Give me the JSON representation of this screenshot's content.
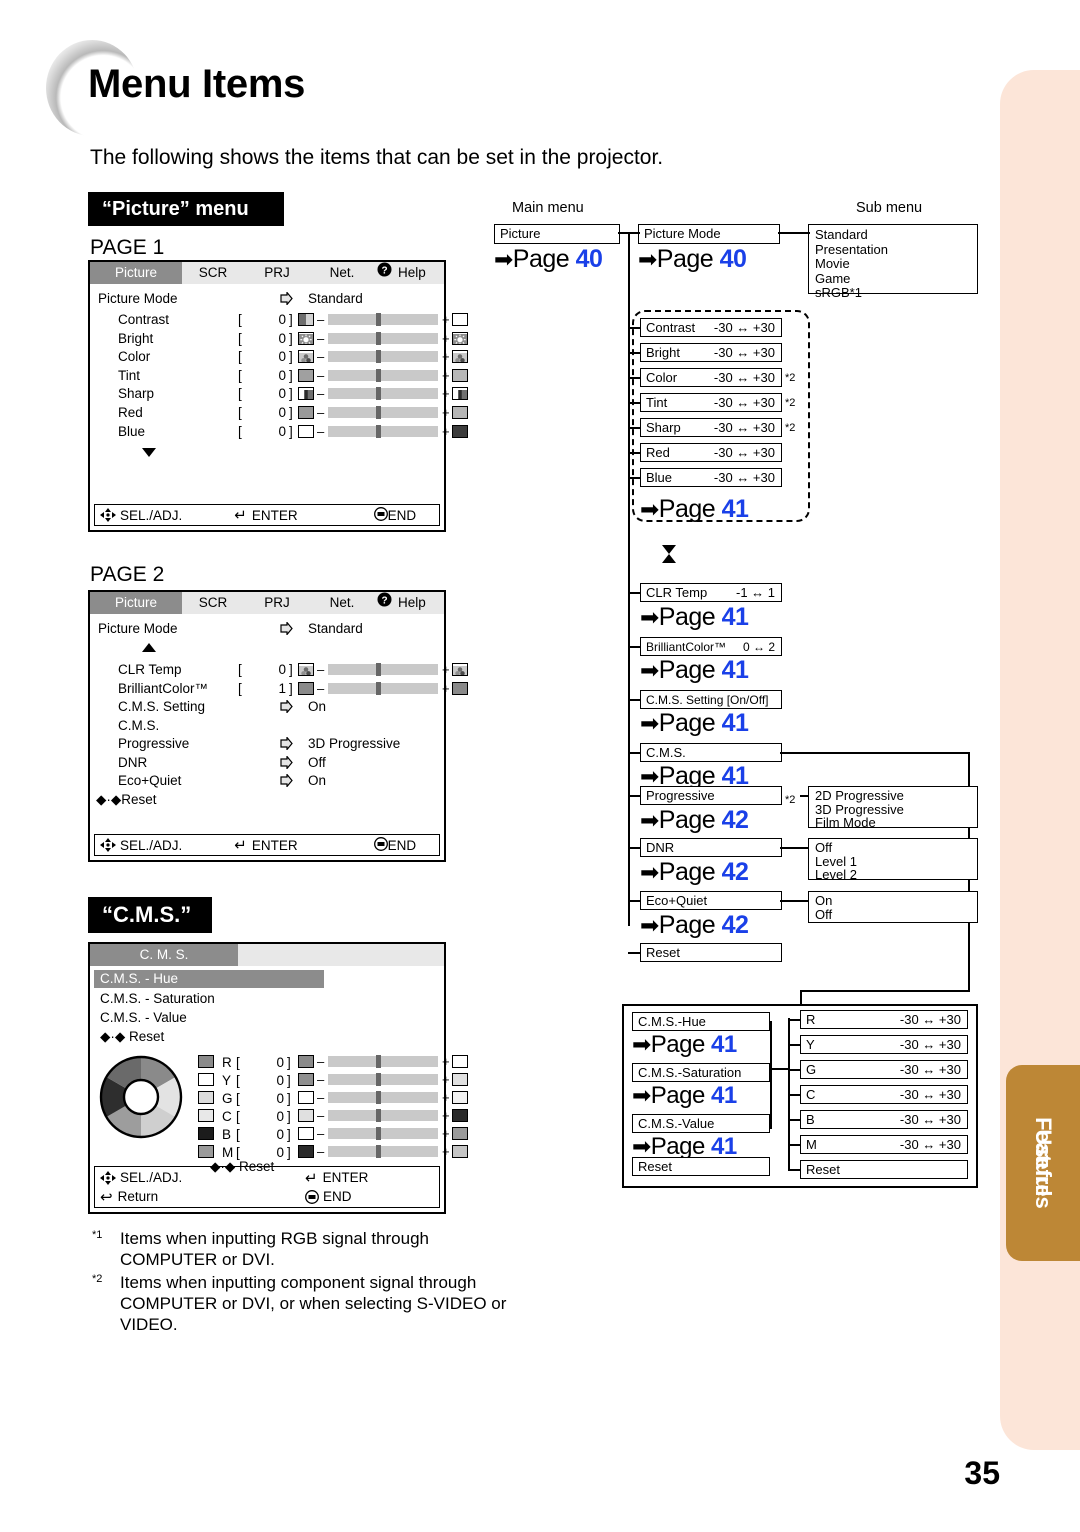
{
  "header": {
    "title": "Menu Items",
    "intro": "The following shows the items that can be set in the projector.",
    "picture_band": "“Picture” menu",
    "cms_band": "“C.M.S.”",
    "page1_label": "PAGE 1",
    "page2_label": "PAGE 2"
  },
  "osd": {
    "tabs": [
      "Picture",
      "SCR",
      "PRJ",
      "Net.",
      "Help"
    ],
    "help_icon": "question-mark-icon",
    "footer": {
      "sel": "SEL./ADJ.",
      "enter": "ENTER",
      "end": "END",
      "return": "Return"
    },
    "page1": {
      "picture_mode_label": "Picture Mode",
      "picture_mode_value": "Standard",
      "rows": [
        {
          "label": "Contrast",
          "value": "0"
        },
        {
          "label": "Bright",
          "value": "0"
        },
        {
          "label": "Color",
          "value": "0"
        },
        {
          "label": "Tint",
          "value": "0"
        },
        {
          "label": "Sharp",
          "value": "0"
        },
        {
          "label": "Red",
          "value": "0"
        },
        {
          "label": "Blue",
          "value": "0"
        }
      ]
    },
    "page2": {
      "picture_mode_label": "Picture Mode",
      "picture_mode_value": "Standard",
      "sliders": [
        {
          "label": "CLR Temp",
          "value": "0"
        },
        {
          "label": "BrilliantColor™",
          "value": "1"
        }
      ],
      "items": [
        {
          "label": "C.M.S. Setting",
          "value": "On"
        },
        {
          "label": "C.M.S.",
          "value": ""
        },
        {
          "label": "Progressive",
          "value": "3D Progressive"
        },
        {
          "label": "DNR",
          "value": "Off"
        },
        {
          "label": "Eco+Quiet",
          "value": "On"
        }
      ],
      "reset": "Reset"
    },
    "cms": {
      "tab": "C. M. S.",
      "menu": [
        "C.M.S. - Hue",
        "C.M.S. - Saturation",
        "C.M.S. - Value"
      ],
      "reset_top": "Reset",
      "reset_bottom": "Reset",
      "channels": [
        {
          "label": "R",
          "value": "0"
        },
        {
          "label": "Y",
          "value": "0"
        },
        {
          "label": "G",
          "value": "0"
        },
        {
          "label": "C",
          "value": "0"
        },
        {
          "label": "B",
          "value": "0"
        },
        {
          "label": "M",
          "value": "0"
        }
      ]
    }
  },
  "flow": {
    "main_menu_caption": "Main menu",
    "sub_menu_caption": "Sub menu",
    "picture_box": "Picture",
    "picture_page": "40",
    "picture_mode_box": "Picture Mode",
    "picture_mode_page": "40",
    "picture_mode_options": [
      "Standard",
      "Presentation",
      "Movie",
      "Game",
      "sRGB*1"
    ],
    "adjust_items": [
      {
        "label": "Contrast",
        "range": "-30 ↔ +30",
        "note": ""
      },
      {
        "label": "Bright",
        "range": "-30 ↔ +30",
        "note": ""
      },
      {
        "label": "Color",
        "range": "-30 ↔ +30",
        "note": "*2"
      },
      {
        "label": "Tint",
        "range": "-30 ↔ +30",
        "note": "*2"
      },
      {
        "label": "Sharp",
        "range": "-30 ↔ +30",
        "note": "*2"
      },
      {
        "label": "Red",
        "range": "-30 ↔ +30",
        "note": ""
      },
      {
        "label": "Blue",
        "range": "-30 ↔ +30",
        "note": ""
      }
    ],
    "adjust_page": "41",
    "clr_temp": {
      "label": "CLR Temp",
      "range": "-1 ↔ 1",
      "page": "41"
    },
    "brilliant_color": {
      "label": "BrilliantColor™",
      "range": "0 ↔ 2",
      "page": "41"
    },
    "cms_setting": {
      "label": "C.M.S. Setting [On/Off]",
      "page": "41"
    },
    "cms": {
      "label": "C.M.S.",
      "page": "41"
    },
    "progressive": {
      "label": "Progressive",
      "note": "*2",
      "page": "42",
      "options": [
        "2D Progressive",
        "3D Progressive",
        "Film Mode"
      ]
    },
    "dnr": {
      "label": "DNR",
      "page": "42",
      "options": [
        "Off",
        "Level 1",
        "Level 2"
      ]
    },
    "eco_quiet": {
      "label": "Eco+Quiet",
      "page": "42",
      "options": [
        "On",
        "Off"
      ]
    },
    "reset": "Reset",
    "cms_group": {
      "items": [
        {
          "label": "C.M.S.-Hue",
          "page": "41"
        },
        {
          "label": "C.M.S.-Saturation",
          "page": "41"
        },
        {
          "label": "C.M.S.-Value",
          "page": "41"
        }
      ],
      "reset": "Reset",
      "channels": [
        {
          "label": "R",
          "range": "-30 ↔ +30"
        },
        {
          "label": "Y",
          "range": "-30 ↔ +30"
        },
        {
          "label": "G",
          "range": "-30 ↔ +30"
        },
        {
          "label": "C",
          "range": "-30 ↔ +30"
        },
        {
          "label": "B",
          "range": "-30 ↔ +30"
        },
        {
          "label": "M",
          "range": "-30 ↔ +30"
        }
      ],
      "channel_reset": "Reset"
    }
  },
  "footnotes": [
    {
      "mark": "*1",
      "text": "Items when inputting RGB signal through COMPUTER or DVI."
    },
    {
      "mark": "*2",
      "text": "Items when inputting component signal through COMPUTER or DVI, or when selecting S-VIDEO or VIDEO."
    }
  ],
  "sidebar": {
    "tab_line1": "Useful",
    "tab_line2": "Features",
    "color": "#bd8736"
  },
  "page_number": "35",
  "colors": {
    "accent_blue": "#1a40e8",
    "band_black": "#000000",
    "strip_peach": "#fce5d8"
  }
}
